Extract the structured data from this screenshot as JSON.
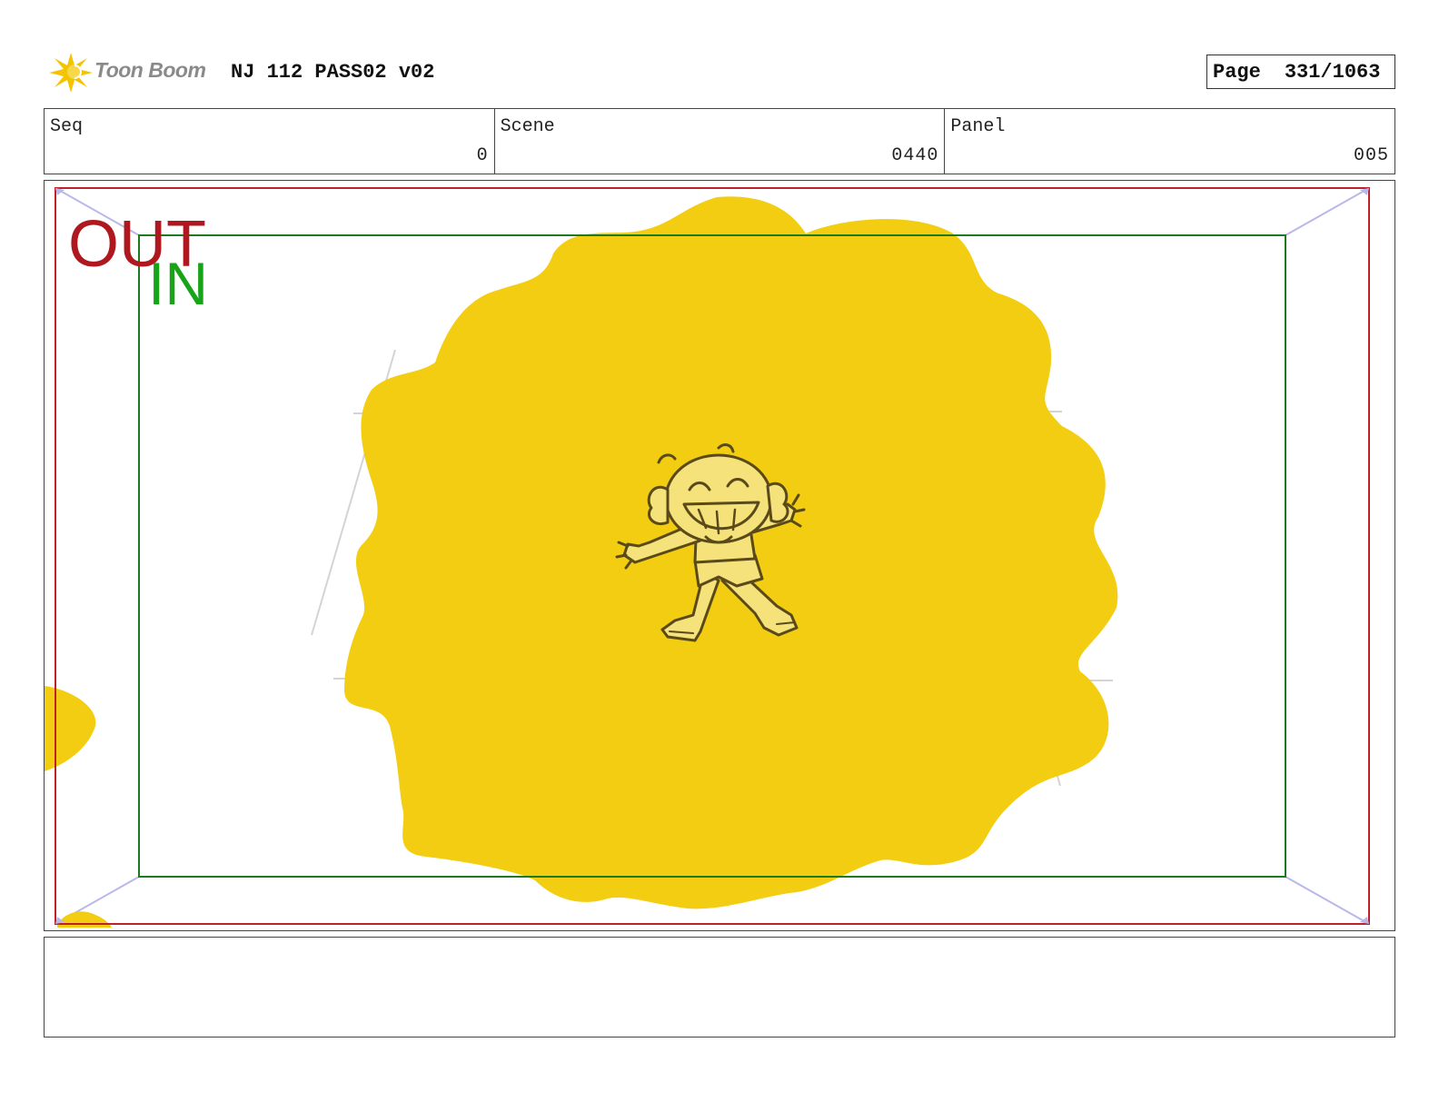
{
  "header": {
    "logo_text": "Toon Boom",
    "project_title": "NJ 112 PASS02 v02",
    "page_label": "Page",
    "page_number": "331/1063"
  },
  "info": {
    "seq_label": "Seq",
    "seq_value": "0",
    "scene_label": "Scene",
    "scene_value": "0440",
    "panel_label": "Panel",
    "panel_value": "005"
  },
  "panel": {
    "out_label": "OUT",
    "in_label": "IN",
    "colors": {
      "out_frame": "#c0202a",
      "in_frame": "#1e7a1e",
      "blob": "#f2cd12",
      "character_line": "#5a4a1a",
      "character_fill": "#f6e27a"
    }
  },
  "notes": {
    "text": ""
  }
}
